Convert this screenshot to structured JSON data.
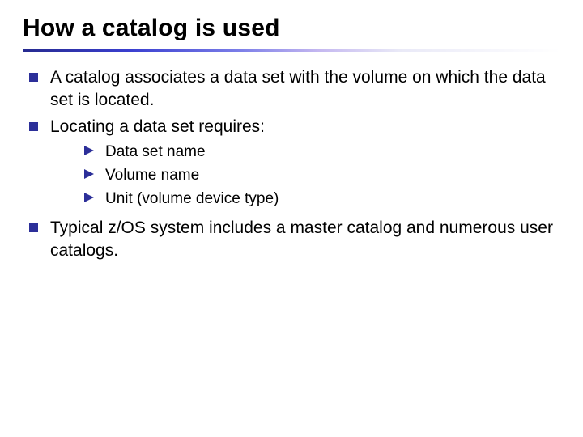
{
  "title": "How a catalog is used",
  "bullets": {
    "b1": "A catalog associates a data set with the volume on which the data set is located.",
    "b2": "Locating a data set requires:",
    "b3": "Typical z/OS system includes a master catalog and numerous user catalogs."
  },
  "sub": {
    "s1": "Data set name",
    "s2": "Volume name",
    "s3": "Unit (volume device type)"
  }
}
